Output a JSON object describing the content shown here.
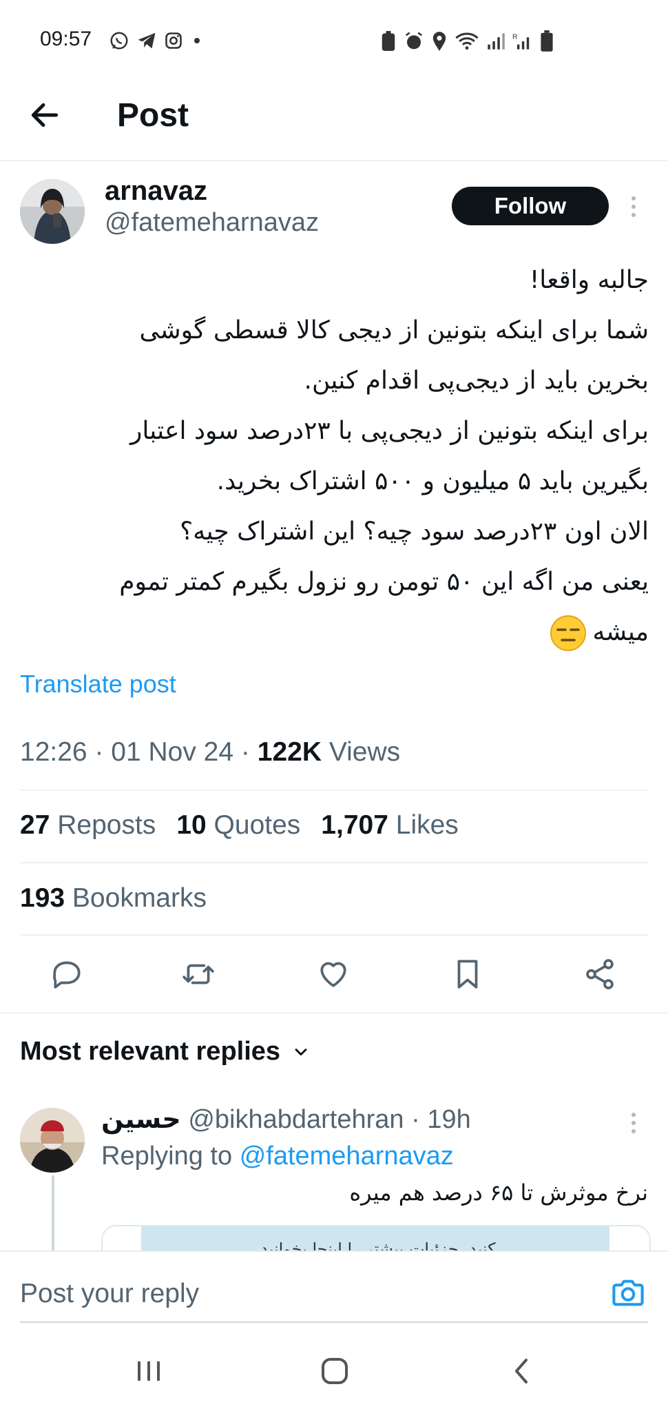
{
  "status_bar": {
    "time": "09:57",
    "left_icons": [
      "whatsapp-icon",
      "telegram-icon",
      "instagram-icon",
      "dot-icon"
    ],
    "right_icons": [
      "battery-saver-icon",
      "alarm-icon",
      "location-icon",
      "wifi-icon",
      "signal-icon",
      "signal-roaming-icon",
      "battery-icon"
    ]
  },
  "header": {
    "title": "Post"
  },
  "author": {
    "name": "arnavaz",
    "handle": "@fatemeharnavaz",
    "follow_label": "Follow"
  },
  "post": {
    "lines": [
      "جالبه واقعا!",
      "شما برای اینکه بتونین از دیجی کالا قسطی گوشی",
      "بخرین باید از دیجی‌پی اقدام کنین.",
      "برای اینکه بتونین از دیجی‌پی با ۲۳درصد سود اعتبار",
      "بگیرین باید ۵ میلیون و ۵۰۰ اشتراک بخرید.",
      "الان اون ۲۳درصد سود چیه؟ این اشتراک چیه؟",
      " یعنی من اگه این ۵۰ تومن رو نزول بگیرم کمتر تموم",
      "میشه"
    ],
    "emoji": "expressionless-face-emoji",
    "translate_label": "Translate post",
    "time": "12:26",
    "date": "01 Nov 24",
    "views_count": "122K",
    "views_label": "Views"
  },
  "stats": {
    "reposts_count": "27",
    "reposts_label": "Reposts",
    "quotes_count": "10",
    "quotes_label": "Quotes",
    "likes_count": "1,707",
    "likes_label": "Likes",
    "bookmarks_count": "193",
    "bookmarks_label": "Bookmarks"
  },
  "actions": [
    "reply-icon",
    "repost-icon",
    "like-icon",
    "bookmark-icon",
    "share-icon"
  ],
  "replies": {
    "heading": "Most relevant replies",
    "items": [
      {
        "name": "حسین",
        "handle": "@bikhabdartehran",
        "time": "19h",
        "replying_prefix": "Replying to",
        "replying_to": "@fatemeharnavaz",
        "text": "نرخ موثرش تا ۶۵ درصد هم میره",
        "card_text": "کنید. جزئیات بیشتر را اینجا بخوانید."
      }
    ]
  },
  "composer": {
    "placeholder": "Post your reply"
  },
  "colors": {
    "accent": "#1d9bf0",
    "text": "#0f1419",
    "muted": "#536471",
    "follow_bg": "#0f1419"
  }
}
